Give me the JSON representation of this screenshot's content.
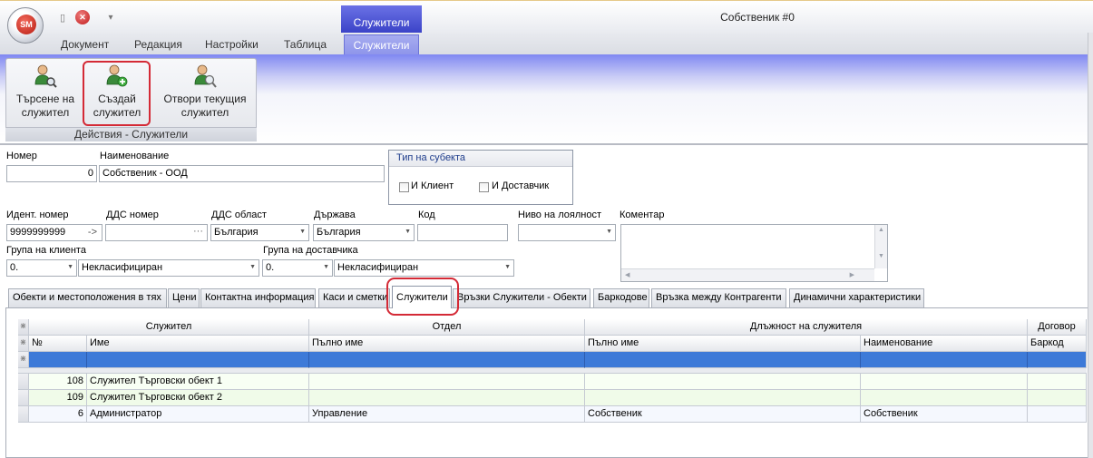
{
  "window": {
    "ctx_tab": "Служители",
    "title": "Собственик #0",
    "orb": "SM"
  },
  "ribbon": {
    "tabs": [
      "Документ",
      "Редакция",
      "Настройки",
      "Таблица",
      "Служители"
    ],
    "group_label": "Действия - Служители",
    "buttons": [
      {
        "line1": "Търсене на",
        "line2": "служител",
        "icon": "search-employee-icon"
      },
      {
        "line1": "Създай",
        "line2": "служител",
        "icon": "add-employee-icon"
      },
      {
        "line1": "Отвори текущия",
        "line2": "служител",
        "icon": "open-employee-icon"
      }
    ]
  },
  "form": {
    "number_label": "Номер",
    "number_value": "0",
    "name_label": "Наименование",
    "name_value": "Собственик - ООД",
    "subject_type_title": "Тип на субекта",
    "chk_client": "И Клиент",
    "chk_supplier": "И Доставчик",
    "ident_label": "Идент. номер",
    "ident_value": "9999999999",
    "ident_arrow": "->",
    "vat_label": "ДДС номер",
    "vat_btn": "···",
    "vat_region_label": "ДДС област",
    "vat_region_value": "България",
    "country_label": "Държава",
    "country_value": "България",
    "code_label": "Код",
    "loyalty_label": "Ниво на лоялност",
    "comment_label": "Коментар",
    "client_group_label": "Група на клиента",
    "client_group_code": "0.",
    "client_group_value": "Некласифициран",
    "supplier_group_label": "Група на доставчика",
    "supplier_group_code": "0.",
    "supplier_group_value": "Некласифициран"
  },
  "tabs": [
    "Обекти и местоположения в тях",
    "Цени",
    "Контактна информация",
    "Каси и сметки",
    "Служители",
    "Връзки Служители - Обекти",
    "Баркодове",
    "Връзка между Контрагенти",
    "Динамични характеристики"
  ],
  "grid": {
    "group_headers": [
      "Служител",
      "Отдел",
      "Длъжност на служителя",
      "Договор"
    ],
    "columns": [
      "№",
      "Име",
      "Пълно име",
      "Пълно име",
      "Наименование",
      "Баркод"
    ],
    "rows": [
      {
        "no": "108",
        "name": "Служител Търговски обект 1",
        "dept": "",
        "pos_full": "",
        "pos_name": "",
        "barcode": ""
      },
      {
        "no": "109",
        "name": "Служител Търговски обект 2",
        "dept": "",
        "pos_full": "",
        "pos_name": "",
        "barcode": ""
      },
      {
        "no": "6",
        "name": "Администратор",
        "dept": "Управление",
        "pos_full": "Собственик",
        "pos_name": "Собственик",
        "barcode": ""
      }
    ]
  },
  "colors": {
    "accent": "#3b43c8",
    "selected_row": "#3d7ad8",
    "highlight": "#d42a36"
  }
}
